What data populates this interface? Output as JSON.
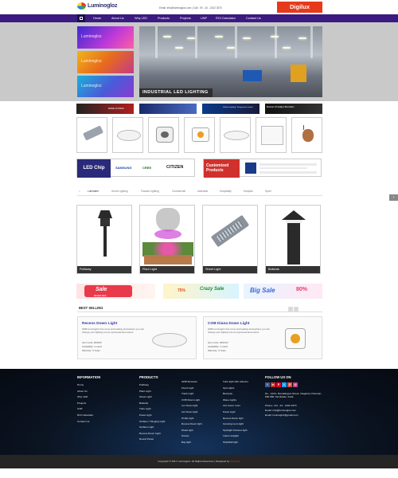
{
  "header": {
    "logo_text": "Luminogloz",
    "contact_line": "Email: info@luminogloz.com | Call : 09 - 44 - 2242 3370",
    "digilux_text": "Digilux"
  },
  "nav": {
    "items": [
      "Home",
      "About Us",
      "Why LED",
      "Products",
      "Projects",
      "UNP",
      "ROI Calculator",
      "Contact Us"
    ]
  },
  "hero": {
    "side_banners": [
      "Luminogloz",
      "Luminogloz",
      "Luminogloz"
    ],
    "caption": "INDUSTRIAL LED LIGHTING"
  },
  "promo_strip": [
    "MADE IN INDIA",
    "",
    "Uniform Lighting / Temperature Control",
    "Business of Intelligent Illumination"
  ],
  "brands": {
    "led_chip": "LED Chip",
    "names": [
      "SAMSUNG",
      "CREE",
      "CITIZEN"
    ],
    "customized_line1": "Customized",
    "customized_line2": "Products"
  },
  "category_tabs": [
    "Luminaire",
    "Home Lighting",
    "Facade Lighting",
    "Commercial",
    "Industrial",
    "Hospitality",
    "Hospital",
    "Sport"
  ],
  "products": [
    "Pathway",
    "Plant Light",
    "Street Light",
    "Bollards"
  ],
  "sales": {
    "sale1": "Sale",
    "sale1_sub": "limited time",
    "sale2_pct": "75%",
    "sale2_word": "Crazy Sale",
    "sale3": "Big Sale",
    "sale3_pct": "80%"
  },
  "best_selling": {
    "title": "BEST SELLING",
    "cards": [
      {
        "title": "Recess Down Light",
        "desc": "GDB Luminogloz has come and leading atmosphere you can change your lighting into an unprecedented extent.",
        "code": "Item Code: #20405",
        "availability": "Availability: in stock",
        "warranty": "Warranty: 3 Years"
      },
      {
        "title": "COB Diana Down Light",
        "desc": "GDB Luminogloz has come and leading atmosphere you can change your lighting into an unprecedented extent.",
        "code": "Item Code: #402117",
        "availability": "Availability: in stock",
        "warranty": "Warranty: 3 Years"
      }
    ]
  },
  "footer": {
    "information_title": "INFORMATION",
    "information_items": [
      "Home",
      "About Us",
      "Why LED",
      "Projects",
      "UNP",
      "ROI Calculator",
      "Contact Us"
    ],
    "products_title": "PRODUCTS",
    "products_col1": [
      "Pathway",
      "Plant Light",
      "Street Light",
      "Bollards",
      "Tube Light",
      "Panel Light",
      "Surface / Hanging Light",
      "Surface Light",
      "Recess Down Light",
      "Round Panel"
    ],
    "products_col2": [
      "GDB Emission",
      "Flood Light",
      "Track Light",
      "COB Down Light",
      "1x1 Down light",
      "2x2 Down light",
      "Profile light",
      "Recess Down light",
      "Diode light",
      "Panels",
      "Bay light"
    ],
    "products_col3": [
      "Tube light with reflector",
      "Spot lights",
      "Bed jetty",
      "Wave Lights",
      "2x2 Cover room",
      "Panel Light",
      "Recess Down light",
      "Growing room light",
      "Spotlight Fixtures light",
      "Indoor skylight",
      "Strip/Rail light"
    ],
    "follow_title": "FOLLOW US ON",
    "social": [
      "f",
      "in",
      "P",
      "t",
      "G",
      "@"
    ],
    "address": "No - 12/11, Ramalingam Street, Ulagaram Chennai - 600 090, Tamilnadu, India.",
    "phone": "Phone: +91 - 44 - 2242 3370",
    "email1": "Email: info@luminogloz.com",
    "email2": "Email: luminogloz@gmail.com",
    "copyright": "Copyright © 2017 Luminogloz. All Rights Reserved. | Designed by",
    "designer": "Tech Fox"
  },
  "colors": {
    "nav": "#3b1b80",
    "digilux": "#e63a1a",
    "footer": "#0b1422"
  }
}
